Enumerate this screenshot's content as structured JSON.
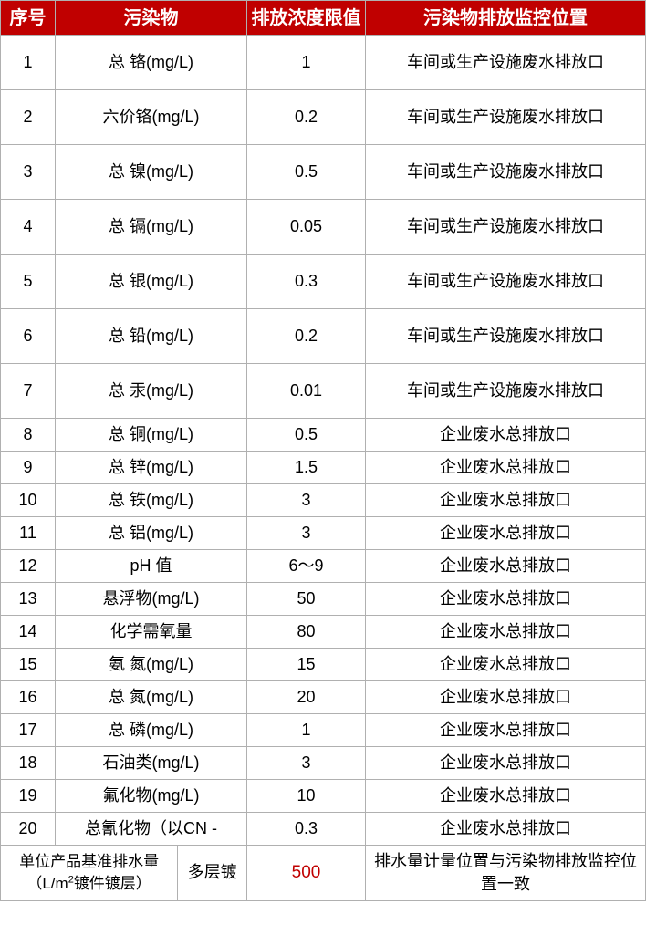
{
  "headers": {
    "num": "序号",
    "pollutant": "污染物",
    "limit": "排放浓度限值",
    "location": "污染物排放监控位置"
  },
  "rows": [
    {
      "num": "1",
      "pollutant": "总  铬(mg/L)",
      "limit": "1",
      "location": "车间或生产设施废水排放口",
      "tall": true
    },
    {
      "num": "2",
      "pollutant": "六价铬(mg/L)",
      "limit": "0.2",
      "location": "车间或生产设施废水排放口",
      "tall": true
    },
    {
      "num": "3",
      "pollutant": "总  镍(mg/L)",
      "limit": "0.5",
      "location": "车间或生产设施废水排放口",
      "tall": true
    },
    {
      "num": "4",
      "pollutant": "总  镉(mg/L)",
      "limit": "0.05",
      "location": "车间或生产设施废水排放口",
      "tall": true
    },
    {
      "num": "5",
      "pollutant": "总  银(mg/L)",
      "limit": "0.3",
      "location": "车间或生产设施废水排放口",
      "tall": true
    },
    {
      "num": "6",
      "pollutant": "总  铅(mg/L)",
      "limit": "0.2",
      "location": "车间或生产设施废水排放口",
      "tall": true
    },
    {
      "num": "7",
      "pollutant": "总  汞(mg/L)",
      "limit": "0.01",
      "location": "车间或生产设施废水排放口",
      "tall": true
    },
    {
      "num": "8",
      "pollutant": "总  铜(mg/L)",
      "limit": "0.5",
      "location": "企业废水总排放口",
      "tall": false
    },
    {
      "num": "9",
      "pollutant": "总  锌(mg/L)",
      "limit": "1.5",
      "location": "企业废水总排放口",
      "tall": false
    },
    {
      "num": "10",
      "pollutant": "总  铁(mg/L)",
      "limit": "3",
      "location": "企业废水总排放口",
      "tall": false
    },
    {
      "num": "11",
      "pollutant": "总  铝(mg/L)",
      "limit": "3",
      "location": "企业废水总排放口",
      "tall": false
    },
    {
      "num": "12",
      "pollutant": "pH 值",
      "limit": "6～9",
      "location": "企业废水总排放口",
      "tall": false
    },
    {
      "num": "13",
      "pollutant": "悬浮物(mg/L)",
      "limit": "50",
      "location": "企业废水总排放口",
      "tall": false
    },
    {
      "num": "14",
      "pollutant": "化学需氧量",
      "limit": "80",
      "location": "企业废水总排放口",
      "tall": false
    },
    {
      "num": "15",
      "pollutant": "氨  氮(mg/L)",
      "limit": "15",
      "location": "企业废水总排放口",
      "tall": false
    },
    {
      "num": "16",
      "pollutant": "总  氮(mg/L)",
      "limit": "20",
      "location": "企业废水总排放口",
      "tall": false
    },
    {
      "num": "17",
      "pollutant": "总  磷(mg/L)",
      "limit": "1",
      "location": "企业废水总排放口",
      "tall": false
    },
    {
      "num": "18",
      "pollutant": "石油类(mg/L)",
      "limit": "3",
      "location": "企业废水总排放口",
      "tall": false
    },
    {
      "num": "19",
      "pollutant": "氟化物(mg/L)",
      "limit": "10",
      "location": "企业废水总排放口",
      "tall": false
    },
    {
      "num": "20",
      "pollutant": "总氰化物（以CN -",
      "limit": "0.3",
      "location": "企业废水总排放口",
      "tall": false
    }
  ],
  "footer": {
    "label_pre": "单位产品基准排水量（L/m",
    "label_sup": "2",
    "label_post": "镀件镀层）",
    "sub": "多层镀",
    "value": "500",
    "location": "排水量计量位置与污染物排放监控位置一致"
  }
}
